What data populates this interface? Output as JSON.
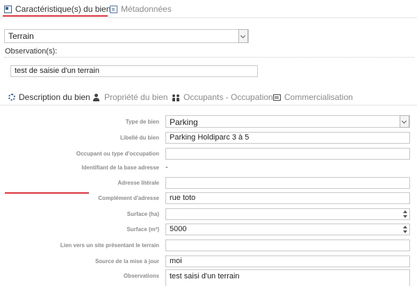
{
  "top_tabs": {
    "bien": "Caractéristique(s) du bien",
    "meta": "Métadonnées"
  },
  "terrain_select": {
    "value": "Terrain"
  },
  "observations_section": {
    "label": "Observation(s):",
    "value": "test de saisie d'un terrain"
  },
  "sub_tabs": {
    "description": "Description du bien",
    "propriete": "Propriété du bien",
    "occupants": "Occupants - Occupation",
    "commercialisation": "Commercialisation"
  },
  "form": {
    "type_bien": {
      "label": "Type de bien",
      "value": "Parking"
    },
    "libelle": {
      "label": "Libellé du bien",
      "value": "Parking Holdiparc 3 à 5"
    },
    "occupant": {
      "label": "Occupant ou type d'occupation",
      "value": ""
    },
    "identifiant": {
      "label": "Identifiant de la base adresse",
      "value": "-"
    },
    "adresse": {
      "label": "Adresse litérale",
      "value": ""
    },
    "complement": {
      "label": "Complément d'adresse",
      "value": "rue toto"
    },
    "surface_ha": {
      "label": "Surface (ha)",
      "value": ""
    },
    "surface_m2": {
      "label": "Surface (m²)",
      "value": "5000"
    },
    "lien": {
      "label": "Lien vers un site présentant le terrain",
      "value": ""
    },
    "source": {
      "label": "Source de la mise à jour",
      "value": "moi"
    },
    "observations": {
      "label": "Observations",
      "value": "test saisi d'un terrain"
    }
  },
  "colors": {
    "accent": "#d8343f",
    "label": "#8c8c8c",
    "border": "#c8c8c8"
  }
}
